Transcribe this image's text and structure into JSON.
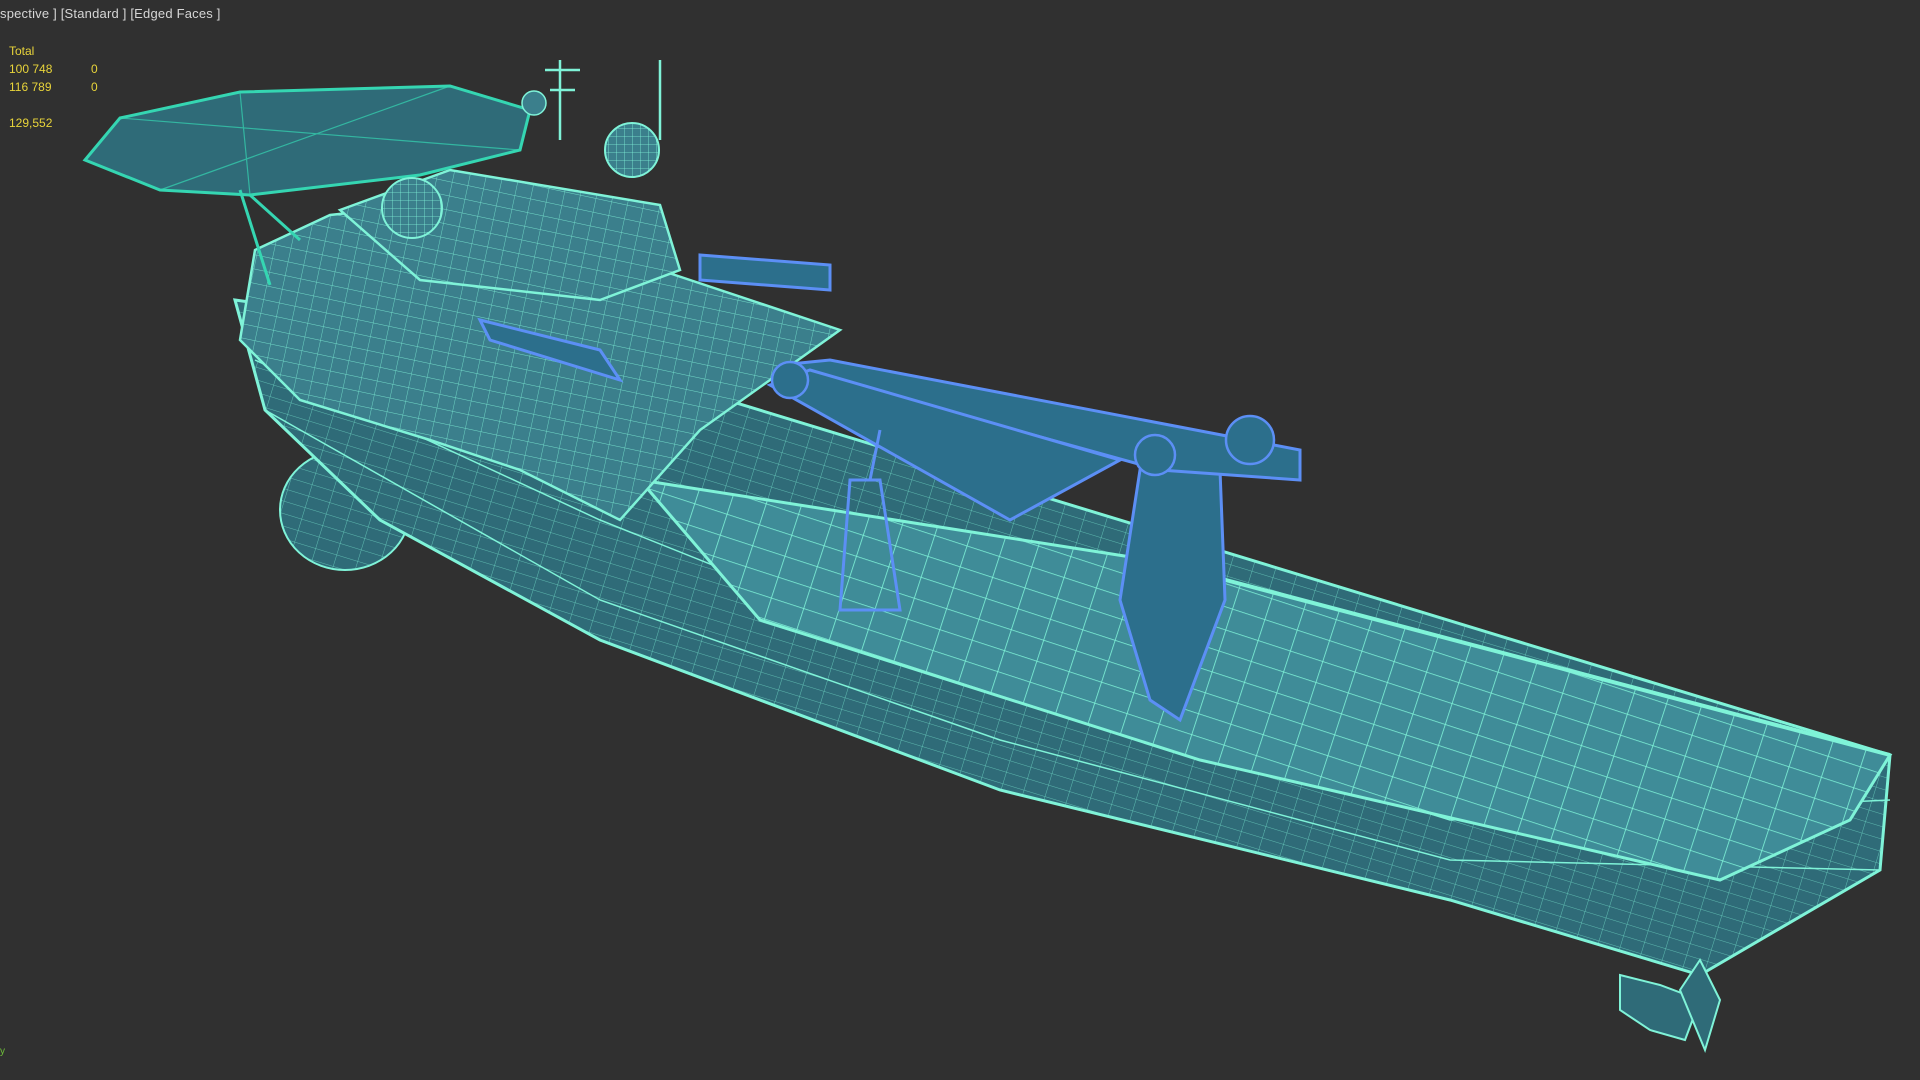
{
  "viewport": {
    "label_view": "spective ]",
    "label_shading": "[Standard ]",
    "label_mode": "[Edged Faces ]"
  },
  "stats": {
    "heading": "Total",
    "rows": [
      {
        "a": "100 748",
        "b": "0"
      },
      {
        "a": "116 789",
        "b": "0"
      }
    ],
    "fps": "129,552"
  },
  "axis_char": "y",
  "colors": {
    "background": "#303030",
    "hull_fill": "#2f6b78",
    "wire": "#7ff3d8",
    "selected_wire": "#5c8ff5",
    "stats_text": "#e8d43a"
  }
}
